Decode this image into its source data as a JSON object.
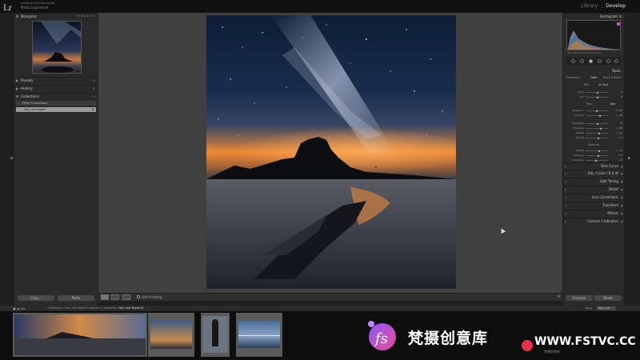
{
  "app": {
    "logo": "Lr",
    "identity_line1": "instagram@iamnudarge",
    "identity_line2": "Mikko Lagerstedt"
  },
  "modules": {
    "library": "Library",
    "separator": "|",
    "develop": "Develop"
  },
  "left_panel": {
    "navigator": {
      "title": "Navigator",
      "controls": "FIT  FILL  1:1  3:1"
    },
    "presets": {
      "title": "Presets",
      "control": "+"
    },
    "history": {
      "title": "History",
      "control": "×"
    },
    "collections": {
      "title": "Collections",
      "control": "+",
      "filter_label": "Filter Collections",
      "items": [
        {
          "label": "Day and Night",
          "count": "8"
        }
      ]
    },
    "copy_label": "Copy...",
    "paste_label": "Paste"
  },
  "toolbar": {
    "soft_proofing_label": "Soft Proofing"
  },
  "right_panel": {
    "histogram": {
      "title": "Histogram",
      "info": "ISO 6400  14mm  f/2.8  15 sec"
    },
    "basic": {
      "title": "Basic",
      "treatment": [
        "Treatment :",
        "Color",
        "Black & White"
      ],
      "wb_label": "WB :",
      "wb_value": "As Shot",
      "tone_label": "Tone",
      "tone_auto": "Auto",
      "presence_label": "Presence",
      "wb_sliders": [
        {
          "label": "Temp",
          "value": "0"
        },
        {
          "label": "Tint",
          "value": "0"
        }
      ],
      "tone_sliders": [
        {
          "label": "Exposure",
          "value": "– 0.20"
        },
        {
          "label": "Contrast",
          "value": "+ 18"
        },
        {
          "label": "Highlights",
          "value": "0"
        },
        {
          "label": "Shadows",
          "value": "+ 30"
        },
        {
          "label": "Whites",
          "value": "+ 11"
        },
        {
          "label": "Blacks",
          "value": "+ 7"
        }
      ],
      "presence_sliders": [
        {
          "label": "Clarity",
          "value": "+ 11"
        },
        {
          "label": "Vibrance",
          "value": "+ 6"
        },
        {
          "label": "Saturation",
          "value": "– 8"
        }
      ]
    },
    "sections": [
      {
        "label": "Tone Curve"
      },
      {
        "label": "HSL  /  Color  /  B & W"
      },
      {
        "label": "Split Toning"
      },
      {
        "label": "Detail"
      },
      {
        "label": "Lens Corrections"
      },
      {
        "label": "Transform"
      },
      {
        "label": "Effects"
      },
      {
        "label": "Camera Calibration"
      }
    ],
    "previous_label": "Previous",
    "reset_label": "Reset"
  },
  "filmstrip": {
    "path_prefix": "Collection : Day and Night",
    "path_count": "8 photos /1 selected /",
    "path_file": "Day and Night.tif",
    "filter_label": "Filter :",
    "filter_value": "Filters Off"
  },
  "watermark": {
    "brand": "梵摄创意库",
    "url": "WWW.FSTVC.CC",
    "tag": "梵摄创意库"
  },
  "colors": {
    "panel": "#2a2a2a",
    "center": "#404040",
    "accent_pink": "#e3334f",
    "sky_orange": "#ef8a35"
  }
}
